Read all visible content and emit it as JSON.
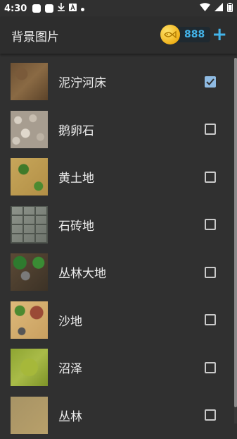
{
  "status_bar": {
    "time": "4:30",
    "icons": [
      "square-notification-icon",
      "square-notification-icon",
      "download-icon",
      "a-icon",
      "dot-icon",
      "wifi-icon",
      "signal-icon",
      "battery-icon"
    ]
  },
  "app_bar": {
    "title": "背景图片",
    "coins": "888",
    "plus_label": "+"
  },
  "backgrounds": [
    {
      "name": "泥泞河床",
      "checked": true,
      "texture": "mud"
    },
    {
      "name": "鹅卵石",
      "checked": false,
      "texture": "pebble"
    },
    {
      "name": "黄土地",
      "checked": false,
      "texture": "loess"
    },
    {
      "name": "石砖地",
      "checked": false,
      "texture": "brick"
    },
    {
      "name": "丛林大地",
      "checked": false,
      "texture": "jungle"
    },
    {
      "name": "沙地",
      "checked": false,
      "texture": "sand"
    },
    {
      "name": "沼泽",
      "checked": false,
      "texture": "swamp"
    },
    {
      "name": "丛林",
      "checked": false,
      "texture": "forest"
    }
  ],
  "colors": {
    "background": "#303030",
    "accent_blue": "#43b4ea",
    "checkbox_checked": "#8fbbe3",
    "coin_gold": "#f0b21a"
  }
}
